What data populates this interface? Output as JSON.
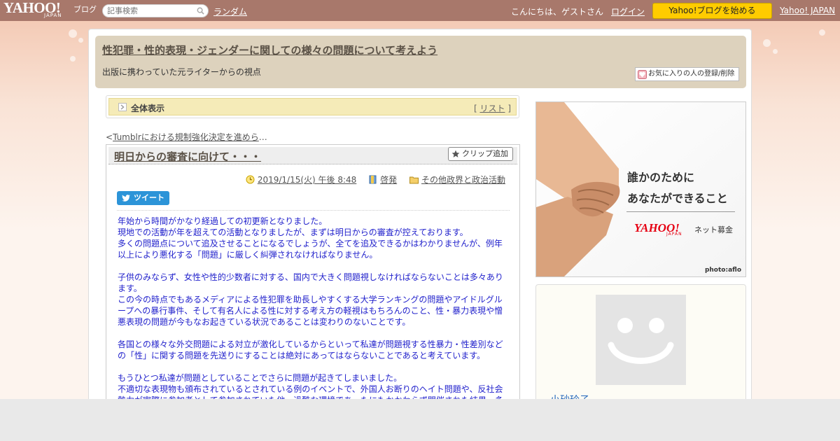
{
  "topbar": {
    "logo_text": "YAHOO!",
    "logo_sub": "JAPAN",
    "logo_service": "ブログ",
    "search_placeholder": "記事検索",
    "random_link": "ランダム",
    "greeting": "こんにちは、ゲストさん",
    "login_link": "ログイン",
    "start_button": "Yahoo!ブログを始める",
    "yahoo_japan_link": "Yahoo! JAPAN"
  },
  "blog": {
    "title": "性犯罪・性的表現・ジェンダーに関しての様々の問題について考えよう",
    "description": "出版に携わっていた元ライターからの視点",
    "favorite_button": "お気に入りの人の登録/削除"
  },
  "view_bar": {
    "label": "全体表示",
    "list_prefix": "[",
    "list_link": "リスト",
    "list_suffix": "]"
  },
  "prev_article": {
    "prefix": "<",
    "title": "Tumblrにおける規制強化決定を進めら",
    "ellipsis": "…"
  },
  "article": {
    "title": "明日からの審査に向けて・・・",
    "clip_button": "クリップ追加",
    "date": "2019/1/15(火) 午後 8:48",
    "tag": "啓発",
    "category": "その他政界と政治活動",
    "tweet_button": "ツイート",
    "paragraphs": [
      [
        "年始から時間がかなり経過しての初更新となりました。",
        "現地での活動が年を超えての活動となりましたが、まずは明日からの審査が控えております。",
        "多くの問題点について追及させることになるでしょうが、全てを追及できるかはわかりませんが、例年以上により悪化する「問題」に厳しく糾弾されなければなりません。"
      ],
      [
        "子供のみならず、女性や性的少数者に対する、国内で大きく問題視しなければならないことは多々あります。",
        "この今の時点でもあるメディアによる性犯罪を助長しやすくする大学ランキングの問題やアイドルグループへの暴行事件、そして有名人による性に対する考え方の軽視はもちろんのこと、性・暴力表現や憎悪表現の問題が今もなお起きている状況であることは変わりのないことです。"
      ],
      [
        "各国との様々な外交問題による対立が激化しているからといって私達が問題視する性暴力・性差別などの「性」に関する問題を先送りにすることは絶対にあってはならないことであると考えています。"
      ],
      [
        "もうひとつ私達が問題としていることでさらに問題が起きてしまいました。",
        "不適切な表現物も頒布されているとされている例のイベントで、外国人お断りのヘイト問題や、反社会勢力が実際に参加者として参加されていた他、過酷な環境であったにもかかわらず開催された結果、多"
      ]
    ]
  },
  "ad": {
    "line1": "誰かのために",
    "line2": "あなたができること",
    "brand": "YAHOO!",
    "brand_sub": "JAPAN",
    "service": "ネット募金",
    "credit": "photo:aflo"
  },
  "profile": {
    "name": "小砂玲子"
  },
  "colors": {
    "topbar": "#a8786b",
    "header": "#ddd2bd",
    "start_button": "#ffcc00",
    "body_text": "#2222cc",
    "tweet": "#2c94d8"
  }
}
